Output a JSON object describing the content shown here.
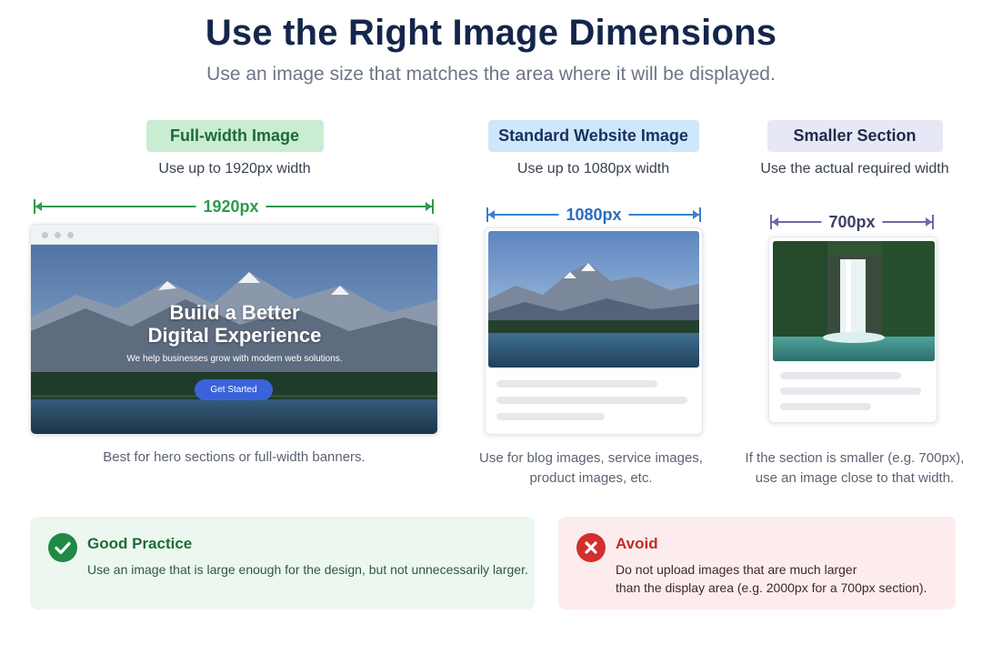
{
  "header": {
    "title": "Use the Right Image Dimensions",
    "subtitle": "Use an image size that matches the area where it will be displayed."
  },
  "columns": [
    {
      "badge": "Full-width Image",
      "width_note": "Use up to 1920px width",
      "measure_label": "1920px",
      "caption": "Best for hero sections or full-width banners.",
      "color": "#2e9a4d",
      "badge_bg": "#c9ecd3",
      "badge_text": "#1c6b34"
    },
    {
      "badge": "Standard Website Image",
      "width_note": "Use up to 1080px width",
      "measure_label": "1080px",
      "caption_lines": [
        "Use for blog images, service images,",
        "product images, etc."
      ],
      "color": "#3b7fd0",
      "badge_bg": "#cfe7fb",
      "badge_text": "#17325e"
    },
    {
      "badge": "Smaller Section",
      "width_note": "Use the actual required width",
      "measure_label": "700px",
      "caption_lines": [
        "If the section is smaller (e.g. 700px),",
        "use an image close to that width."
      ],
      "color": "#6a6aa8",
      "badge_bg": "#e6e8f6",
      "badge_text": "#1f2a48"
    }
  ],
  "hero": {
    "heading_line1": "Build a Better",
    "heading_line2": "Digital Experience",
    "tagline": "We help businesses grow with modern web solutions.",
    "button": "Get Started"
  },
  "good": {
    "title": "Good Practice",
    "body": "Use an image that is large enough for the design, but not unnecessarily larger.",
    "color": "#1f8a44"
  },
  "avoid": {
    "title": "Avoid",
    "body_line1": "Do not upload images that are much larger",
    "body_line2": "than the display area (e.g. 2000px for a 700px section).",
    "color": "#d32f2f"
  },
  "icons": {
    "good": "check-circle-icon",
    "avoid": "x-circle-icon"
  }
}
